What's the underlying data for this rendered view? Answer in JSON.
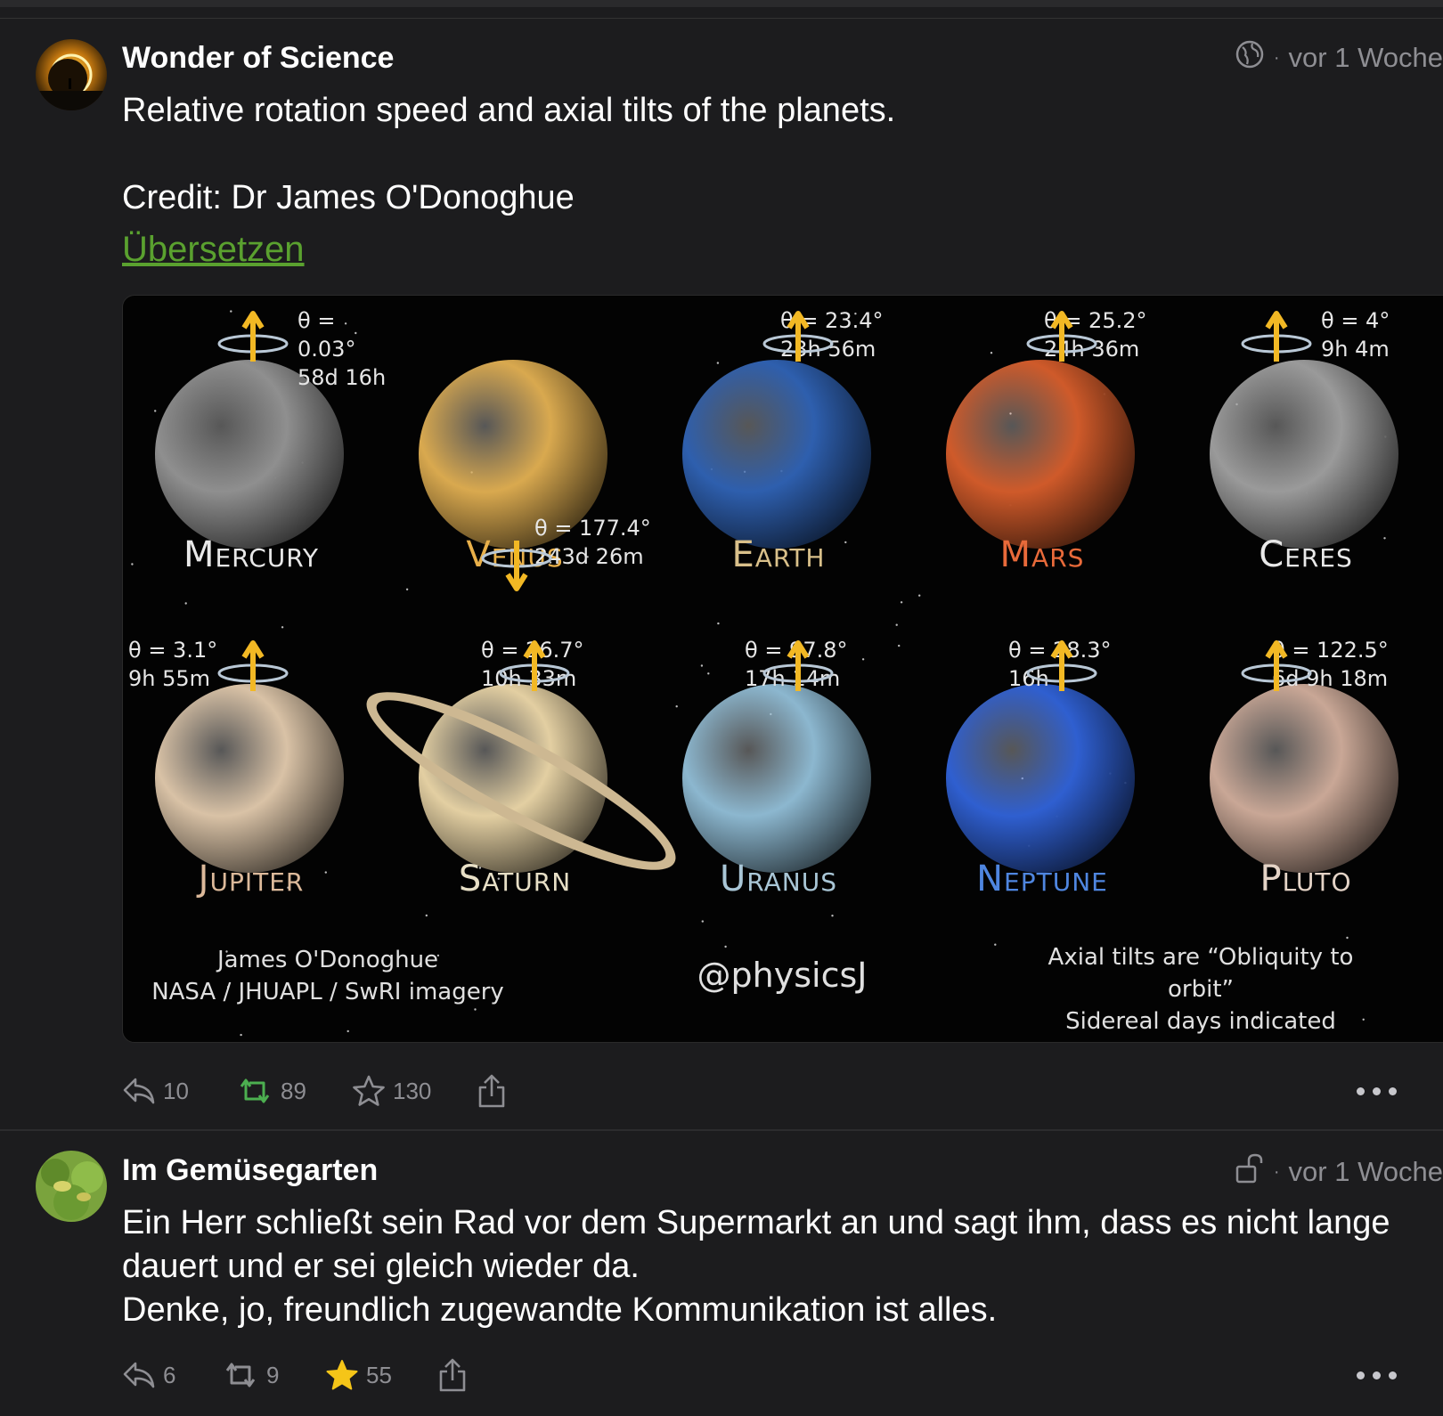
{
  "posts": [
    {
      "author": "Wonder of Science",
      "visibility_icon": "globe-icon",
      "time": "vor 1 Woche",
      "text": "Relative rotation speed and axial tilts of the planets.\n\nCredit: Dr James O'Donoghue",
      "translate_link": "Übersetzen",
      "replies": "10",
      "boosts": "89",
      "favourites": "130",
      "boost_color": "#4caf50"
    },
    {
      "author": "Im Gemüsegarten",
      "visibility_icon": "unlock-icon",
      "time": "vor 1 Woche",
      "text": "Ein Herr schließt sein Rad vor dem Supermarkt an und sagt ihm, dass es nicht lange dauert und er sei gleich wieder da.\nDenke, jo, freundlich zugewandte Kommunikation ist alles.",
      "replies": "6",
      "boosts": "9",
      "favourites": "55",
      "favourite_color": "#f5c518"
    }
  ],
  "media": {
    "planets": [
      {
        "name": "Mercury",
        "info": "θ = 0.03°\n58d 16h",
        "label_color": "#e8e8e8",
        "surface": "#8f8f8f"
      },
      {
        "name": "Venus",
        "info": "θ = 177.4°\n243d 26m",
        "label_color": "#e9b04a",
        "surface": "#d9a94f"
      },
      {
        "name": "Earth",
        "info": "θ = 23.4°\n23h 56m",
        "label_color": "#d9c08a",
        "surface": "#2e5fae"
      },
      {
        "name": "Mars",
        "info": "θ = 25.2°\n24h 36m",
        "label_color": "#e86a3a",
        "surface": "#cf5a2a"
      },
      {
        "name": "Ceres",
        "info": "θ = 4°\n9h 4m",
        "label_color": "#e8e8e8",
        "surface": "#9a9a9a"
      },
      {
        "name": "Jupiter",
        "info": "θ = 3.1°\n9h 55m",
        "label_color": "#dcb99a",
        "surface": "#d9c2a6"
      },
      {
        "name": "Saturn",
        "info": "θ = 26.7°\n10h 33m",
        "label_color": "#e7dfc6",
        "surface": "#e3cfa2"
      },
      {
        "name": "Uranus",
        "info": "θ = 97.8°\n17h 14m",
        "label_color": "#a9c6d6",
        "surface": "#8cb7cf"
      },
      {
        "name": "Neptune",
        "info": "θ = 28.3°\n16h",
        "label_color": "#4f86e0",
        "surface": "#2f5fd0"
      },
      {
        "name": "Pluto",
        "info": "θ = 122.5°\n6d 9h 18m",
        "label_color": "#e4d3c6",
        "surface": "#c9a796"
      }
    ],
    "credit_left": "James O'Donoghue\nNASA / JHUAPL / SwRI imagery",
    "credit_center": "@physicsJ",
    "credit_right": "Axial tilts are “Obliquity to orbit”\nSidereal days indicated"
  }
}
